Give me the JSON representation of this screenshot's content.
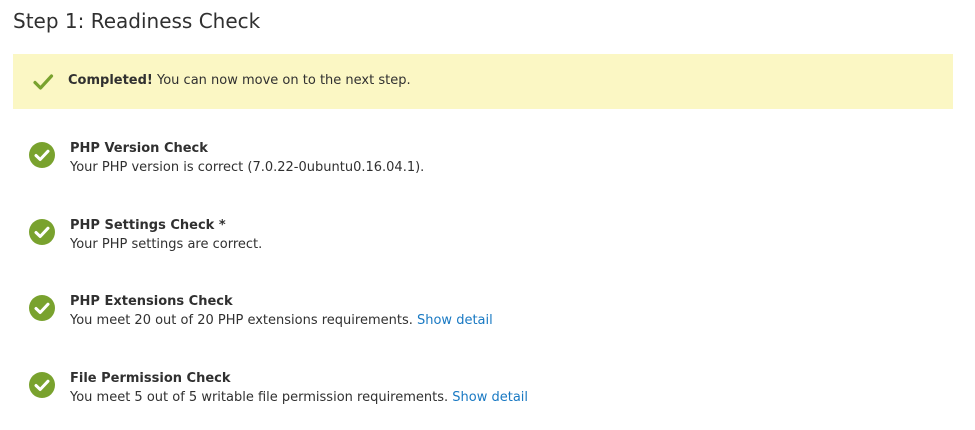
{
  "page": {
    "title": "Step 1: Readiness Check"
  },
  "notice": {
    "icon": "checkmark-icon",
    "strong": "Completed!",
    "text": " You can now move on to the next step.",
    "background": "#fbf7c4",
    "icon_color": "#79a22e"
  },
  "checks": [
    {
      "icon": "success-check-icon",
      "title": "PHP Version Check",
      "description": "Your PHP version is correct (7.0.22-0ubuntu0.16.04.1).",
      "link": ""
    },
    {
      "icon": "success-check-icon",
      "title": "PHP Settings Check *",
      "description": "Your PHP settings are correct.",
      "link": ""
    },
    {
      "icon": "success-check-icon",
      "title": "PHP Extensions Check",
      "description": "You meet 20 out of 20 PHP extensions requirements. ",
      "link": "Show detail"
    },
    {
      "icon": "success-check-icon",
      "title": "File Permission Check",
      "description": "You meet 5 out of 5 writable file permission requirements. ",
      "link": "Show detail"
    }
  ],
  "colors": {
    "success": "#79a22e",
    "link": "#1979c3",
    "text": "#303030"
  }
}
